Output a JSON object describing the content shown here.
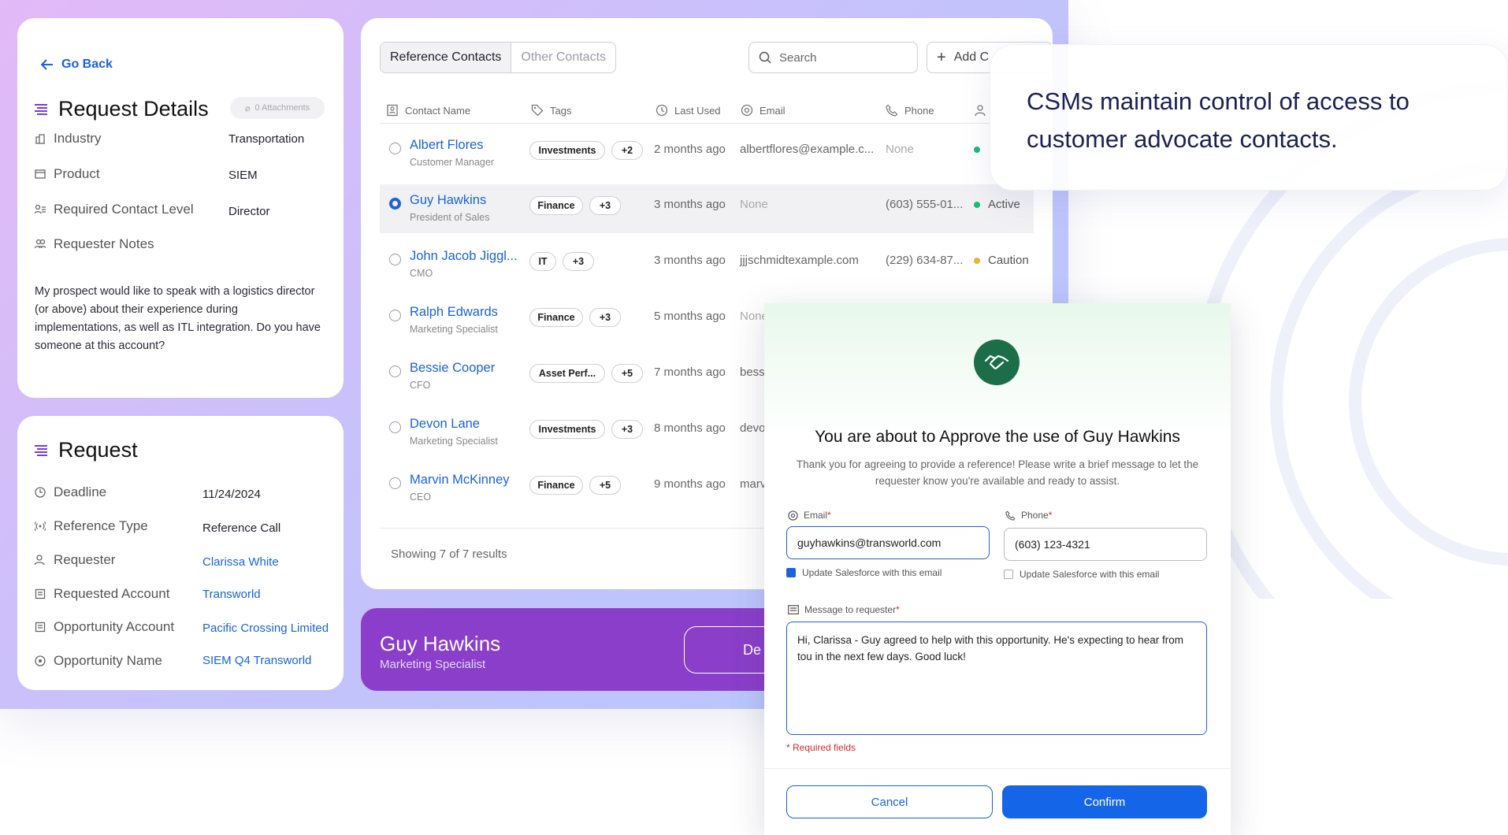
{
  "colors": {
    "link": "#1a63d8",
    "purple": "#8a3ec9",
    "primary": "#1565e8",
    "active": "#1db97a",
    "caution": "#e8b233",
    "required": "#d42a2a"
  },
  "request_details": {
    "go_back": "Go Back",
    "title": "Request Details",
    "attachments": "0 Attachments",
    "rows": [
      {
        "label": "Industry",
        "value": "Transportation",
        "icon": "building-icon"
      },
      {
        "label": "Product",
        "value": "SIEM",
        "icon": "box-icon"
      },
      {
        "label": "Required Contact Level",
        "value": "Director",
        "icon": "level-icon"
      }
    ],
    "notes_label": "Requester Notes",
    "notes": "My prospect would like to speak with a logistics director (or above) about their experience during implementations, as well as ITL integration. Do you have someone at this account?"
  },
  "request": {
    "title": "Request",
    "rows": [
      {
        "label": "Deadline",
        "value": "11/24/2024",
        "link": false
      },
      {
        "label": "Reference Type",
        "value": "Reference Call",
        "link": false
      },
      {
        "label": "Requester",
        "value": "Clarissa White",
        "link": true
      },
      {
        "label": "Requested Account",
        "value": "Transworld",
        "link": true
      },
      {
        "label": "Opportunity Account",
        "value": "Pacific Crossing Limited",
        "link": true
      },
      {
        "label": "Opportunity Name",
        "value": "SIEM Q4 Transworld",
        "link": true
      }
    ]
  },
  "contacts": {
    "tabs": [
      "Reference Contacts",
      "Other Contacts"
    ],
    "search_placeholder": "Search",
    "add_label": "Add C",
    "columns": [
      "Contact Name",
      "Tags",
      "Last Used",
      "Email",
      "Phone"
    ],
    "rows": [
      {
        "name": "Albert Flores",
        "title": "Customer Manager",
        "tag": "Investments",
        "more": "+2",
        "last_used": "2 months ago",
        "email": "albertflores@example.c...",
        "phone": "None",
        "status": ""
      },
      {
        "name": "Guy Hawkins",
        "title": "President of Sales",
        "tag": "Finance",
        "more": "+3",
        "last_used": "3 months ago",
        "email": "None",
        "phone": "(603) 555-01...",
        "status": "Active"
      },
      {
        "name": "John Jacob Jiggl...",
        "title": "CMO",
        "tag": "IT",
        "more": "+3",
        "last_used": "3 months ago",
        "email": "jjjschmidtexample.com",
        "phone": "(229) 634-87...",
        "status": "Caution"
      },
      {
        "name": "Ralph Edwards",
        "title": "Marketing Specialist",
        "tag": "Finance",
        "more": "+3",
        "last_used": "5 months ago",
        "email": "None",
        "phone": "",
        "status": ""
      },
      {
        "name": "Bessie Cooper",
        "title": "CFO",
        "tag": "Asset Perf...",
        "more": "+5",
        "last_used": "7 months ago",
        "email": "bess",
        "phone": "",
        "status": ""
      },
      {
        "name": "Devon Lane",
        "title": "Marketing Specialist",
        "tag": "Investments",
        "more": "+3",
        "last_used": "8 months ago",
        "email": "devo",
        "phone": "",
        "status": ""
      },
      {
        "name": "Marvin McKinney",
        "title": "CEO",
        "tag": "Finance",
        "more": "+5",
        "last_used": "9 months ago",
        "email": "marv",
        "phone": "",
        "status": ""
      }
    ],
    "showing": "Showing 7 of 7 results"
  },
  "selected_contact": {
    "name": "Guy Hawkins",
    "title": "Marketing Specialist",
    "button": "De"
  },
  "callout": "CSMs maintain control of access to customer advocate contacts.",
  "modal": {
    "title": "You are about to Approve the use of Guy Hawkins",
    "description": "Thank you for agreeing to provide a reference! Please write a brief message to let the requester know you're available and ready to assist.",
    "email_label": "Email",
    "email_value": "guyhawkins@transworld.com",
    "phone_label": "Phone",
    "phone_value": "(603) 123-4321",
    "update_email": "Update Salesforce with this email",
    "update_phone": "Update Salesforce with this email",
    "message_label": "Message to requester",
    "message": "Hi, Clarissa - Guy agreed to help with this opportunity. He's expecting to hear from tou in the next few days. Good luck!",
    "required_note": "* Required fields",
    "cancel": "Cancel",
    "confirm": "Confirm"
  }
}
